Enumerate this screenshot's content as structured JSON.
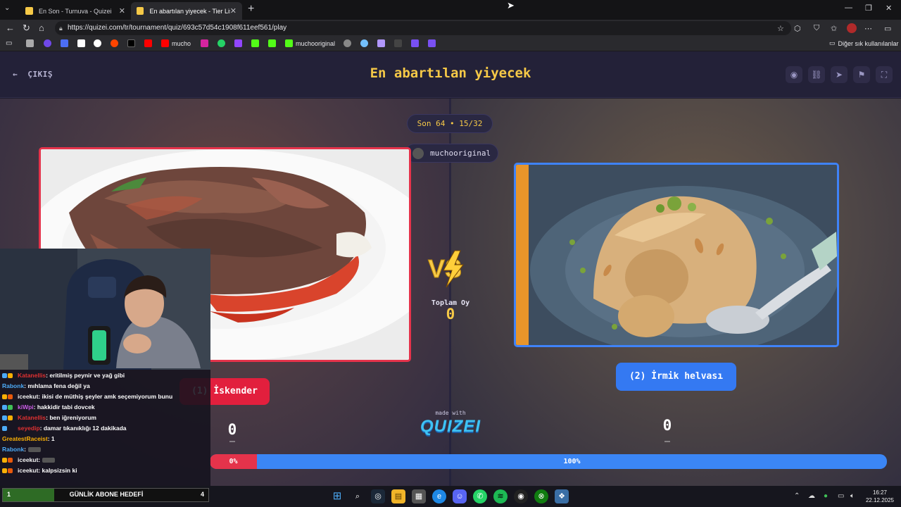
{
  "browser": {
    "tabs": [
      {
        "title": "En Son - Turnuva - Quizei",
        "active": false
      },
      {
        "title": "En abartılan yiyecek - Tier List, Kö",
        "active": true
      }
    ],
    "url": "https://quizei.com/tr/tournament/quiz/693c57d54c1908f611eef561/play",
    "bookmarks": [
      {
        "label": "",
        "icon": "folder-icon"
      },
      {
        "label": "",
        "icon": "image-icon"
      },
      {
        "label": "",
        "icon": "gmail-icon"
      },
      {
        "label": "",
        "icon": "google-icon"
      },
      {
        "label": "",
        "icon": "reddit-icon"
      },
      {
        "label": "",
        "icon": "x-icon"
      },
      {
        "label": "",
        "icon": "youtube-icon"
      },
      {
        "label": "mucho",
        "icon": "youtube-icon"
      },
      {
        "label": "",
        "icon": "instagram-icon"
      },
      {
        "label": "",
        "icon": "whatsapp-icon"
      },
      {
        "label": "",
        "icon": "twitch-icon"
      },
      {
        "label": "",
        "icon": "kick-icon"
      },
      {
        "label": "",
        "icon": "kick-icon"
      },
      {
        "label": "muchooriginal",
        "icon": "kick-icon"
      }
    ],
    "other_bookmarks": "Diğer sık kullanılanlar"
  },
  "quiz": {
    "exit_label": "ÇIKIŞ",
    "title": "En abartılan yiyecek",
    "round_label": "Son 64 • 15/32",
    "user_label": "muchooriginal",
    "total_votes_label": "Toplam Oy",
    "total_votes": "0",
    "left": {
      "button_label": "(1) İskender",
      "votes": "0",
      "percent_label": "0%",
      "percent": 0
    },
    "right": {
      "button_label": "(2) İrmik helvası",
      "votes": "0",
      "percent_label": "100%",
      "percent": 100
    },
    "made_with": "made with",
    "logo": "QUIZEI"
  },
  "chat": [
    {
      "user": "Katanellis",
      "user_color": "#e03131",
      "text": ": eritilmiş peynir ve yağ gibi"
    },
    {
      "user": "Rabonk",
      "user_color": "#4dabf7",
      "text": ": mıhlama fena değil ya"
    },
    {
      "user": "iceekut",
      "user_color": "#f5f5f5",
      "text": ": ikisi de müthiş şeyler amk seçemiyorum bunu"
    },
    {
      "user": "kiWpi",
      "user_color": "#cc5de8",
      "text": ": hakkidir tabi dovcek"
    },
    {
      "user": "Katanellis",
      "user_color": "#e03131",
      "text": ": ben iğreniyorum"
    },
    {
      "user": "seyedip",
      "user_color": "#e03131",
      "text": ": damar tıkanıklığı 12 dakikada"
    },
    {
      "user": "GreatestRaceist",
      "user_color": "#fab005",
      "text": ": 1"
    },
    {
      "user": "Rabonk",
      "user_color": "#4dabf7",
      "text": ":"
    },
    {
      "user": "iceekut",
      "user_color": "#f5f5f5",
      "text": ":"
    },
    {
      "user": "iceekut",
      "user_color": "#f5f5f5",
      "text": ": kalpsizsin ki"
    }
  ],
  "sub_goal": {
    "current": "1",
    "label": "GÜNLİK ABONE HEDEFİ",
    "target": "4",
    "progress": 0.25
  },
  "taskbar": {
    "time": "16:27",
    "date": "22.12.2025",
    "apps": [
      "windows-start-icon",
      "search-icon",
      "steam-icon",
      "file-explorer-icon",
      "store-icon",
      "edge-icon",
      "discord-icon",
      "whatsapp-icon",
      "spotify-icon",
      "obs-icon",
      "xbox-icon",
      "app-icon"
    ]
  },
  "colors": {
    "accent_red": "#e5334b",
    "accent_blue": "#3b86f5",
    "title_yellow": "#f6c947",
    "header_bg": "#232138"
  }
}
